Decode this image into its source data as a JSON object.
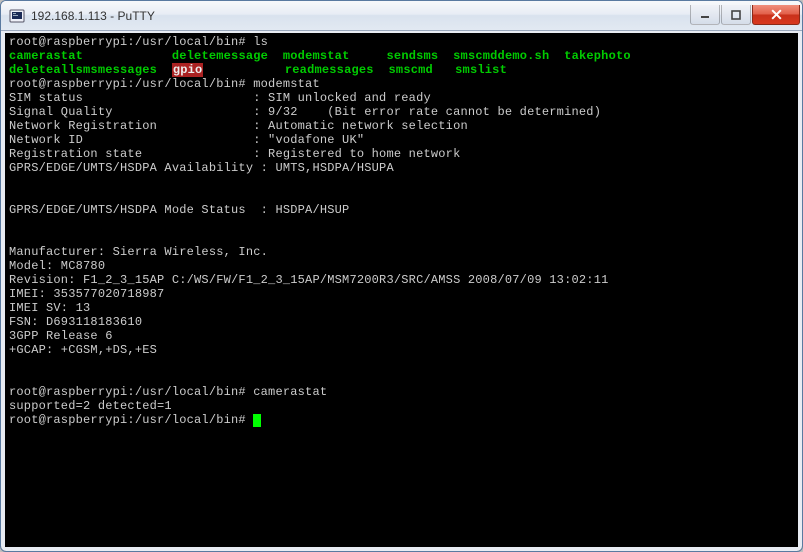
{
  "window": {
    "title": "192.168.1.113 - PuTTY"
  },
  "prompt": "root@raspberrypi:/usr/local/bin#",
  "cmd1": "ls",
  "ls_row1": {
    "c1": "camerastat",
    "c2": "deletemessage",
    "c3": "modemstat",
    "c4": "sendsms",
    "c5": "smscmddemo.sh",
    "c6": "takephoto"
  },
  "ls_row2": {
    "c1": "deleteallsmsmessages",
    "c2": "gpio",
    "c3": "readmessages",
    "c4": "smscmd",
    "c5": "smslist"
  },
  "cmd2": "modemstat",
  "modem": {
    "l1": "SIM status                       : SIM unlocked and ready",
    "l2": "Signal Quality                   : 9/32    (Bit error rate cannot be determined)",
    "l3": "Network Registration             : Automatic network selection",
    "l4": "Network ID                       : \"vodafone UK\"",
    "l5": "Registration state               : Registered to home network",
    "l6": "GPRS/EDGE/UMTS/HSDPA Availability : UMTS,HSDPA/HSUPA",
    "l7": "GPRS/EDGE/UMTS/HSDPA Mode Status  : HSDPA/HSUP",
    "l8": "Manufacturer: Sierra Wireless, Inc.",
    "l9": "Model: MC8780",
    "l10": "Revision: F1_2_3_15AP C:/WS/FW/F1_2_3_15AP/MSM7200R3/SRC/AMSS 2008/07/09 13:02:11",
    "l11": "IMEI: 353577020718987",
    "l12": "IMEI SV: 13",
    "l13": "FSN: D693118183610",
    "l14": "3GPP Release 6",
    "l15": "+GCAP: +CGSM,+DS,+ES"
  },
  "cmd3": "camerastat",
  "camera_out": "supported=2 detected=1"
}
